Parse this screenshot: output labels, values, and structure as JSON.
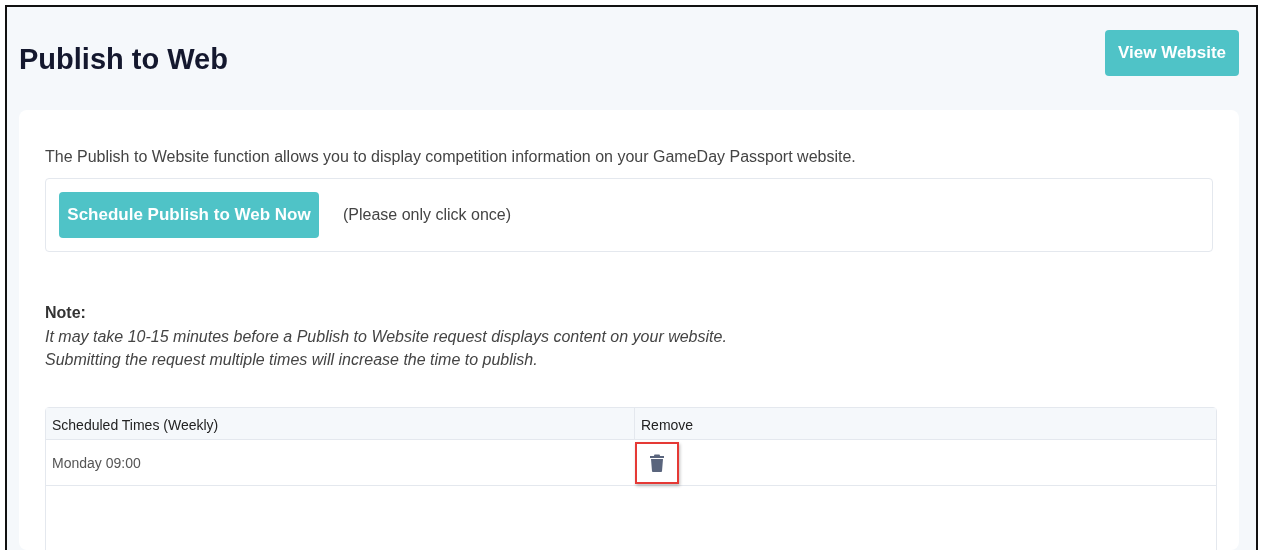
{
  "page": {
    "title": "Publish to Web",
    "view_button": "View Website"
  },
  "intro": "The Publish to Website function allows you to display competition information on your GameDay Passport website.",
  "publish": {
    "button": "Schedule Publish to Web Now",
    "hint": "(Please only click once)"
  },
  "note": {
    "heading": "Note:",
    "lines": [
      "It may take 10-15 minutes before a Publish to Website request displays content on your website.",
      "Submitting the request multiple times will increase the time to publish."
    ]
  },
  "table": {
    "columns": [
      "Scheduled Times (Weekly)",
      "Remove"
    ],
    "rows": [
      {
        "time": "Monday 09:00",
        "highlighted": true
      }
    ]
  }
}
